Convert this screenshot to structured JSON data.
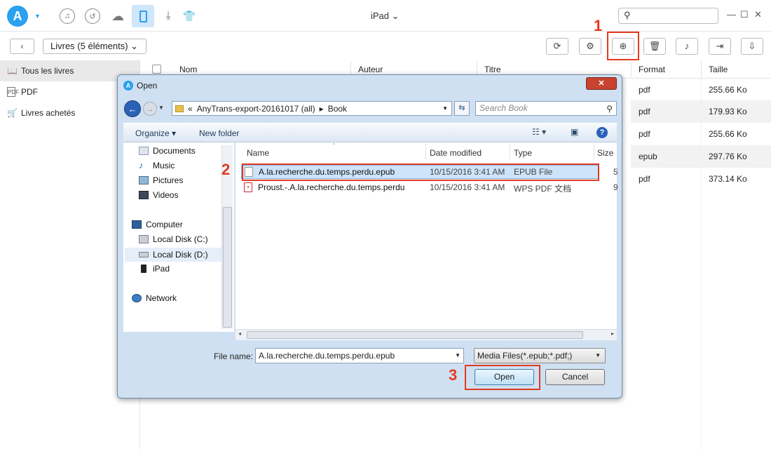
{
  "app": {
    "logo_letter": "A",
    "device_title": "iPad ⌄",
    "accent": "#2aa0f0"
  },
  "top_icons": [
    "music-icon",
    "history-icon",
    "cloud-icon",
    "ipad-icon",
    "download-icon",
    "tshirt-icon"
  ],
  "toolbar": {
    "category_dropdown": "Livres (5 éléments) ⌄",
    "buttons": [
      "refresh-icon",
      "settings-icon",
      "add-icon",
      "delete-icon",
      "itunes-icon",
      "export-icon",
      "to-device-icon"
    ]
  },
  "markers": {
    "one": "1",
    "two": "2",
    "three": "3"
  },
  "sidebar": {
    "items": [
      {
        "label": "Tous les livres",
        "icon": "book-icon"
      },
      {
        "label": "PDF",
        "icon": "pdf-icon"
      },
      {
        "label": "Livres achetés",
        "icon": "cart-icon"
      }
    ]
  },
  "table": {
    "headers": {
      "name": "Nom",
      "author": "Auteur",
      "title": "Titre",
      "format": "Format",
      "size": "Taille"
    },
    "rows": [
      {
        "format": "pdf",
        "size": "255.66 Ko"
      },
      {
        "format": "pdf",
        "size": "179.93 Ko"
      },
      {
        "format": "pdf",
        "size": "255.66 Ko"
      },
      {
        "format": "epub",
        "size": "297.76 Ko"
      },
      {
        "format": "pdf",
        "size": "373.14 Ko"
      }
    ]
  },
  "dialog": {
    "title": "Open",
    "address": {
      "prefix": "«",
      "folder1": "AnyTrans-export-20161017 (all)",
      "sep": "▸",
      "folder2": "Book"
    },
    "search_placeholder": "Search Book",
    "organize": "Organize ▾",
    "new_folder": "New folder",
    "nav": [
      {
        "label": "Documents",
        "icon": "documents-icon"
      },
      {
        "label": "Music",
        "icon": "music-icon"
      },
      {
        "label": "Pictures",
        "icon": "pictures-icon"
      },
      {
        "label": "Videos",
        "icon": "videos-icon"
      },
      {
        "label": "Computer",
        "icon": "computer-icon"
      },
      {
        "label": "Local Disk (C:)",
        "icon": "disk-icon"
      },
      {
        "label": "Local Disk (D:)",
        "icon": "disk-icon"
      },
      {
        "label": "iPad",
        "icon": "ipad-icon"
      },
      {
        "label": "Network",
        "icon": "network-icon"
      }
    ],
    "columns": {
      "name": "Name",
      "date": "Date modified",
      "type": "Type",
      "size": "Size"
    },
    "files": [
      {
        "name": "A.la.recherche.du.temps.perdu.epub",
        "date": "10/15/2016 3:41 AM",
        "type": "EPUB File",
        "size": "5"
      },
      {
        "name": "Proust.-.A.la.recherche.du.temps.perdu",
        "date": "10/15/2016 3:41 AM",
        "type": "WPS PDF 文档",
        "size": "9"
      }
    ],
    "file_name_label": "File name:",
    "file_name_value": "A.la.recherche.du.temps.perdu.epub",
    "filter": "Media Files(*.epub;*.pdf;)",
    "open_button": "Open",
    "cancel_button": "Cancel"
  }
}
